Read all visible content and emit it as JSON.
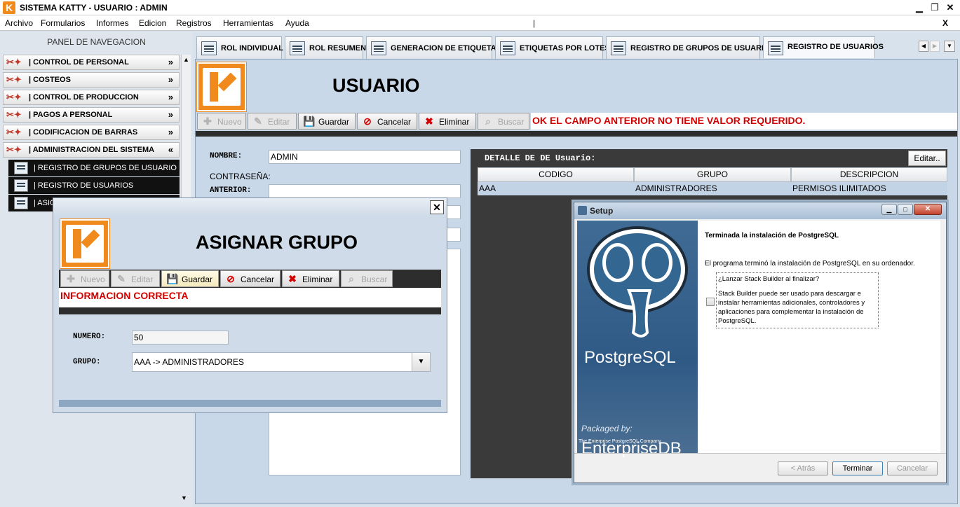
{
  "window": {
    "title": "SISTEMA KATTY - USUARIO :  ADMIN",
    "logo_letter": "K",
    "close_x": "X"
  },
  "menu": [
    "Archivo",
    "Formularios",
    "Informes",
    "Edicion",
    "Registros",
    "Herramientas",
    "Ayuda"
  ],
  "menu_separator": "|",
  "nav": {
    "header": "PANEL DE NAVEGACION",
    "items": [
      {
        "label": "|  CONTROL DE PERSONAL",
        "arrow": "»"
      },
      {
        "label": "|  COSTEOS",
        "arrow": "»"
      },
      {
        "label": "|  CONTROL DE PRODUCCION",
        "arrow": "»"
      },
      {
        "label": "|  PAGOS A PERSONAL",
        "arrow": "»"
      },
      {
        "label": "|  CODIFICACION DE BARRAS",
        "arrow": "»"
      },
      {
        "label": "|  ADMINISTRACION DEL SISTEMA",
        "arrow": "«"
      }
    ],
    "subitems": [
      "| REGISTRO DE GRUPOS DE USUARIO",
      "| REGISTRO DE USUARIOS",
      "| ASIG"
    ]
  },
  "tabs": [
    "ROL INDIVIDUAL",
    "ROL RESUMEN",
    "GENERACION DE ETIQUETAS",
    "ETIQUETAS POR LOTES",
    "REGISTRO DE GRUPOS DE USUARIO",
    "REGISTRO DE USUARIOS"
  ],
  "active_tab": "REGISTRO DE USUARIOS",
  "usuario": {
    "heading": "USUARIO",
    "toolbar": {
      "nuevo": "Nuevo",
      "editar": "Editar",
      "guardar": "Guardar",
      "cancelar": "Cancelar",
      "eliminar": "Eliminar",
      "buscar": "Buscar"
    },
    "message": "OK EL CAMPO ANTERIOR NO TIENE VALOR REQUERIDO.",
    "nombre_label": "NOMBRE:",
    "nombre_value": "ADMIN",
    "contrasena_label": "CONTRASEÑA:",
    "anterior_label": "ANTERIOR:",
    "detalle": {
      "title": "DETALLE DE DE Usuario:",
      "edit_button": "Editar..",
      "columns": [
        "CODIGO",
        "GRUPO",
        "DESCRIPCION"
      ],
      "rows": [
        [
          "AAA",
          "ADMINISTRADORES",
          "PERMISOS ILIMITADOS"
        ]
      ]
    }
  },
  "setup": {
    "title": "Setup",
    "heading": "Terminada la instalación de PostgreSQL",
    "body": "El programa terminó la instalación de PostgreSQL en su ordenador.",
    "check_title": "¿Lanzar Stack Builder al finalizar?",
    "check_desc": "Stack Builder puede ser usado para descargar e instalar herramientas adicionales, controladores y aplicaciones para complementar la instalación de PostgreSQL.",
    "brand": "PostgreSQL",
    "packaged_by": "Packaged by:",
    "vendor": "EnterpriseDB",
    "vendor_sub": "The Enterprise PostgreSQL Company",
    "buttons": {
      "back": "< Atrás",
      "finish": "Terminar",
      "cancel": "Cancelar"
    }
  },
  "asignar": {
    "heading": "ASIGNAR GRUPO",
    "close": "✕",
    "toolbar": {
      "nuevo": "Nuevo",
      "editar": "Editar",
      "guardar": "Guardar",
      "cancelar": "Cancelar",
      "eliminar": "Eliminar",
      "buscar": "Buscar"
    },
    "message": "INFORMACION CORRECTA",
    "numero_label": "NUMERO:",
    "numero_value": "50",
    "grupo_label": "GRUPO:",
    "grupo_value": "AAA -> ADMINISTRADORES"
  },
  "colors": {
    "accent": "#f08a1c",
    "error": "#d40000",
    "nav_sub_bg": "#111111"
  }
}
